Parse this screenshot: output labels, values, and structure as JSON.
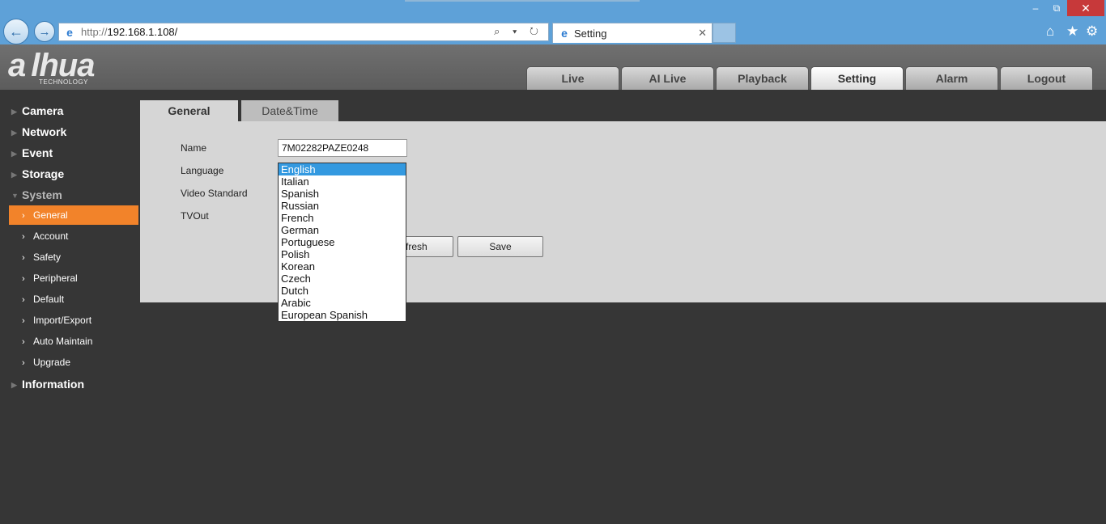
{
  "browser": {
    "url_prefix": "http://",
    "url_host": "192.168.1.108/",
    "tab_title": "Setting",
    "address_tools": "⌕ ▾ ↻",
    "icons": [
      "back-arrow-icon",
      "forward-arrow-icon",
      "ie-icon",
      "search-icon",
      "refresh-icon",
      "home-icon",
      "star-icon",
      "gear-icon"
    ],
    "window_controls": {
      "minimize": "–",
      "maximize": "⧉",
      "close": "✕"
    }
  },
  "header": {
    "logo": "a lhua",
    "logo_sub": "TECHNOLOGY",
    "tabs": [
      {
        "label": "Live"
      },
      {
        "label": "AI Live"
      },
      {
        "label": "Playback"
      },
      {
        "label": "Setting",
        "active": true
      },
      {
        "label": "Alarm"
      },
      {
        "label": "Logout"
      }
    ]
  },
  "sidebar": {
    "sections": [
      {
        "label": "Camera"
      },
      {
        "label": "Network"
      },
      {
        "label": "Event"
      },
      {
        "label": "Storage"
      },
      {
        "label": "System",
        "expanded": true
      },
      {
        "label": "Information"
      }
    ],
    "system_items": [
      {
        "label": "General",
        "active": true
      },
      {
        "label": "Account"
      },
      {
        "label": "Safety"
      },
      {
        "label": "Peripheral"
      },
      {
        "label": "Default"
      },
      {
        "label": "Import/Export"
      },
      {
        "label": "Auto Maintain"
      },
      {
        "label": "Upgrade"
      }
    ],
    "accent_color": "#f2832a"
  },
  "content": {
    "subtabs": [
      {
        "label": "General",
        "active": true
      },
      {
        "label": "Date&Time"
      }
    ],
    "fields": {
      "name_label": "Name",
      "name_value": "7M02282PAZE0248",
      "language_label": "Language",
      "video_standard_label": "Video Standard",
      "tvout_label": "TVOut"
    },
    "buttons": {
      "refresh_visible": "fresh",
      "save": "Save"
    },
    "language_options": [
      "English",
      "Italian",
      "Spanish",
      "Russian",
      "French",
      "German",
      "Portuguese",
      "Polish",
      "Korean",
      "Czech",
      "Dutch",
      "Arabic",
      "European Spanish"
    ],
    "language_selected": "English",
    "selection_color": "#3399e0"
  }
}
